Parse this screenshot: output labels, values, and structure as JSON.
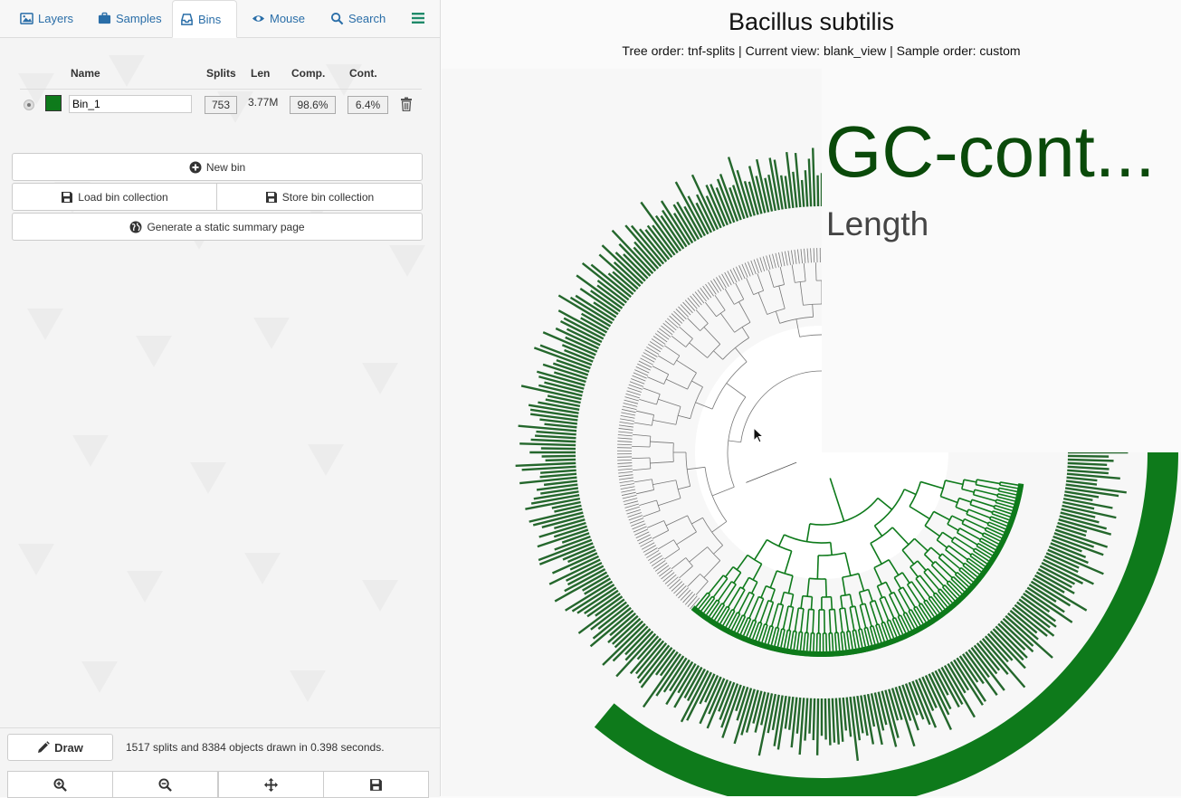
{
  "tabs": [
    {
      "label": "Layers",
      "icon": "image-icon"
    },
    {
      "label": "Samples",
      "icon": "briefcase-icon"
    },
    {
      "label": "Bins",
      "icon": "inbox-icon",
      "active": true
    },
    {
      "label": "Mouse",
      "icon": "eye-icon"
    },
    {
      "label": "Search",
      "icon": "search-icon"
    }
  ],
  "bins_table": {
    "headers": {
      "name": "Name",
      "splits": "Splits",
      "len": "Len",
      "comp": "Comp.",
      "cont": "Cont."
    },
    "rows": [
      {
        "name": "Bin_1",
        "color": "#0e7a1b",
        "splits": "753",
        "len": "3.77M",
        "comp": "98.6%",
        "cont": "6.4%"
      }
    ]
  },
  "buttons": {
    "new_bin": "New bin",
    "load_collection": "Load bin collection",
    "store_collection": "Store bin collection",
    "summary": "Generate a static summary page",
    "draw": "Draw"
  },
  "status": "1517 splits and 8384 objects drawn in 0.398 seconds.",
  "view": {
    "title": "Bacillus subtilis",
    "subtitle": "Tree order: tnf-splits | Current view: blank_view | Sample order: custom",
    "layers": [
      "GC-cont...",
      "Length"
    ]
  },
  "colors": {
    "bin_green": "#0e7a1b",
    "gc_dark": "#24672c",
    "gc_light": "#aac7b0",
    "length_ring": "#555555",
    "accent_link": "#2a6ea8"
  }
}
